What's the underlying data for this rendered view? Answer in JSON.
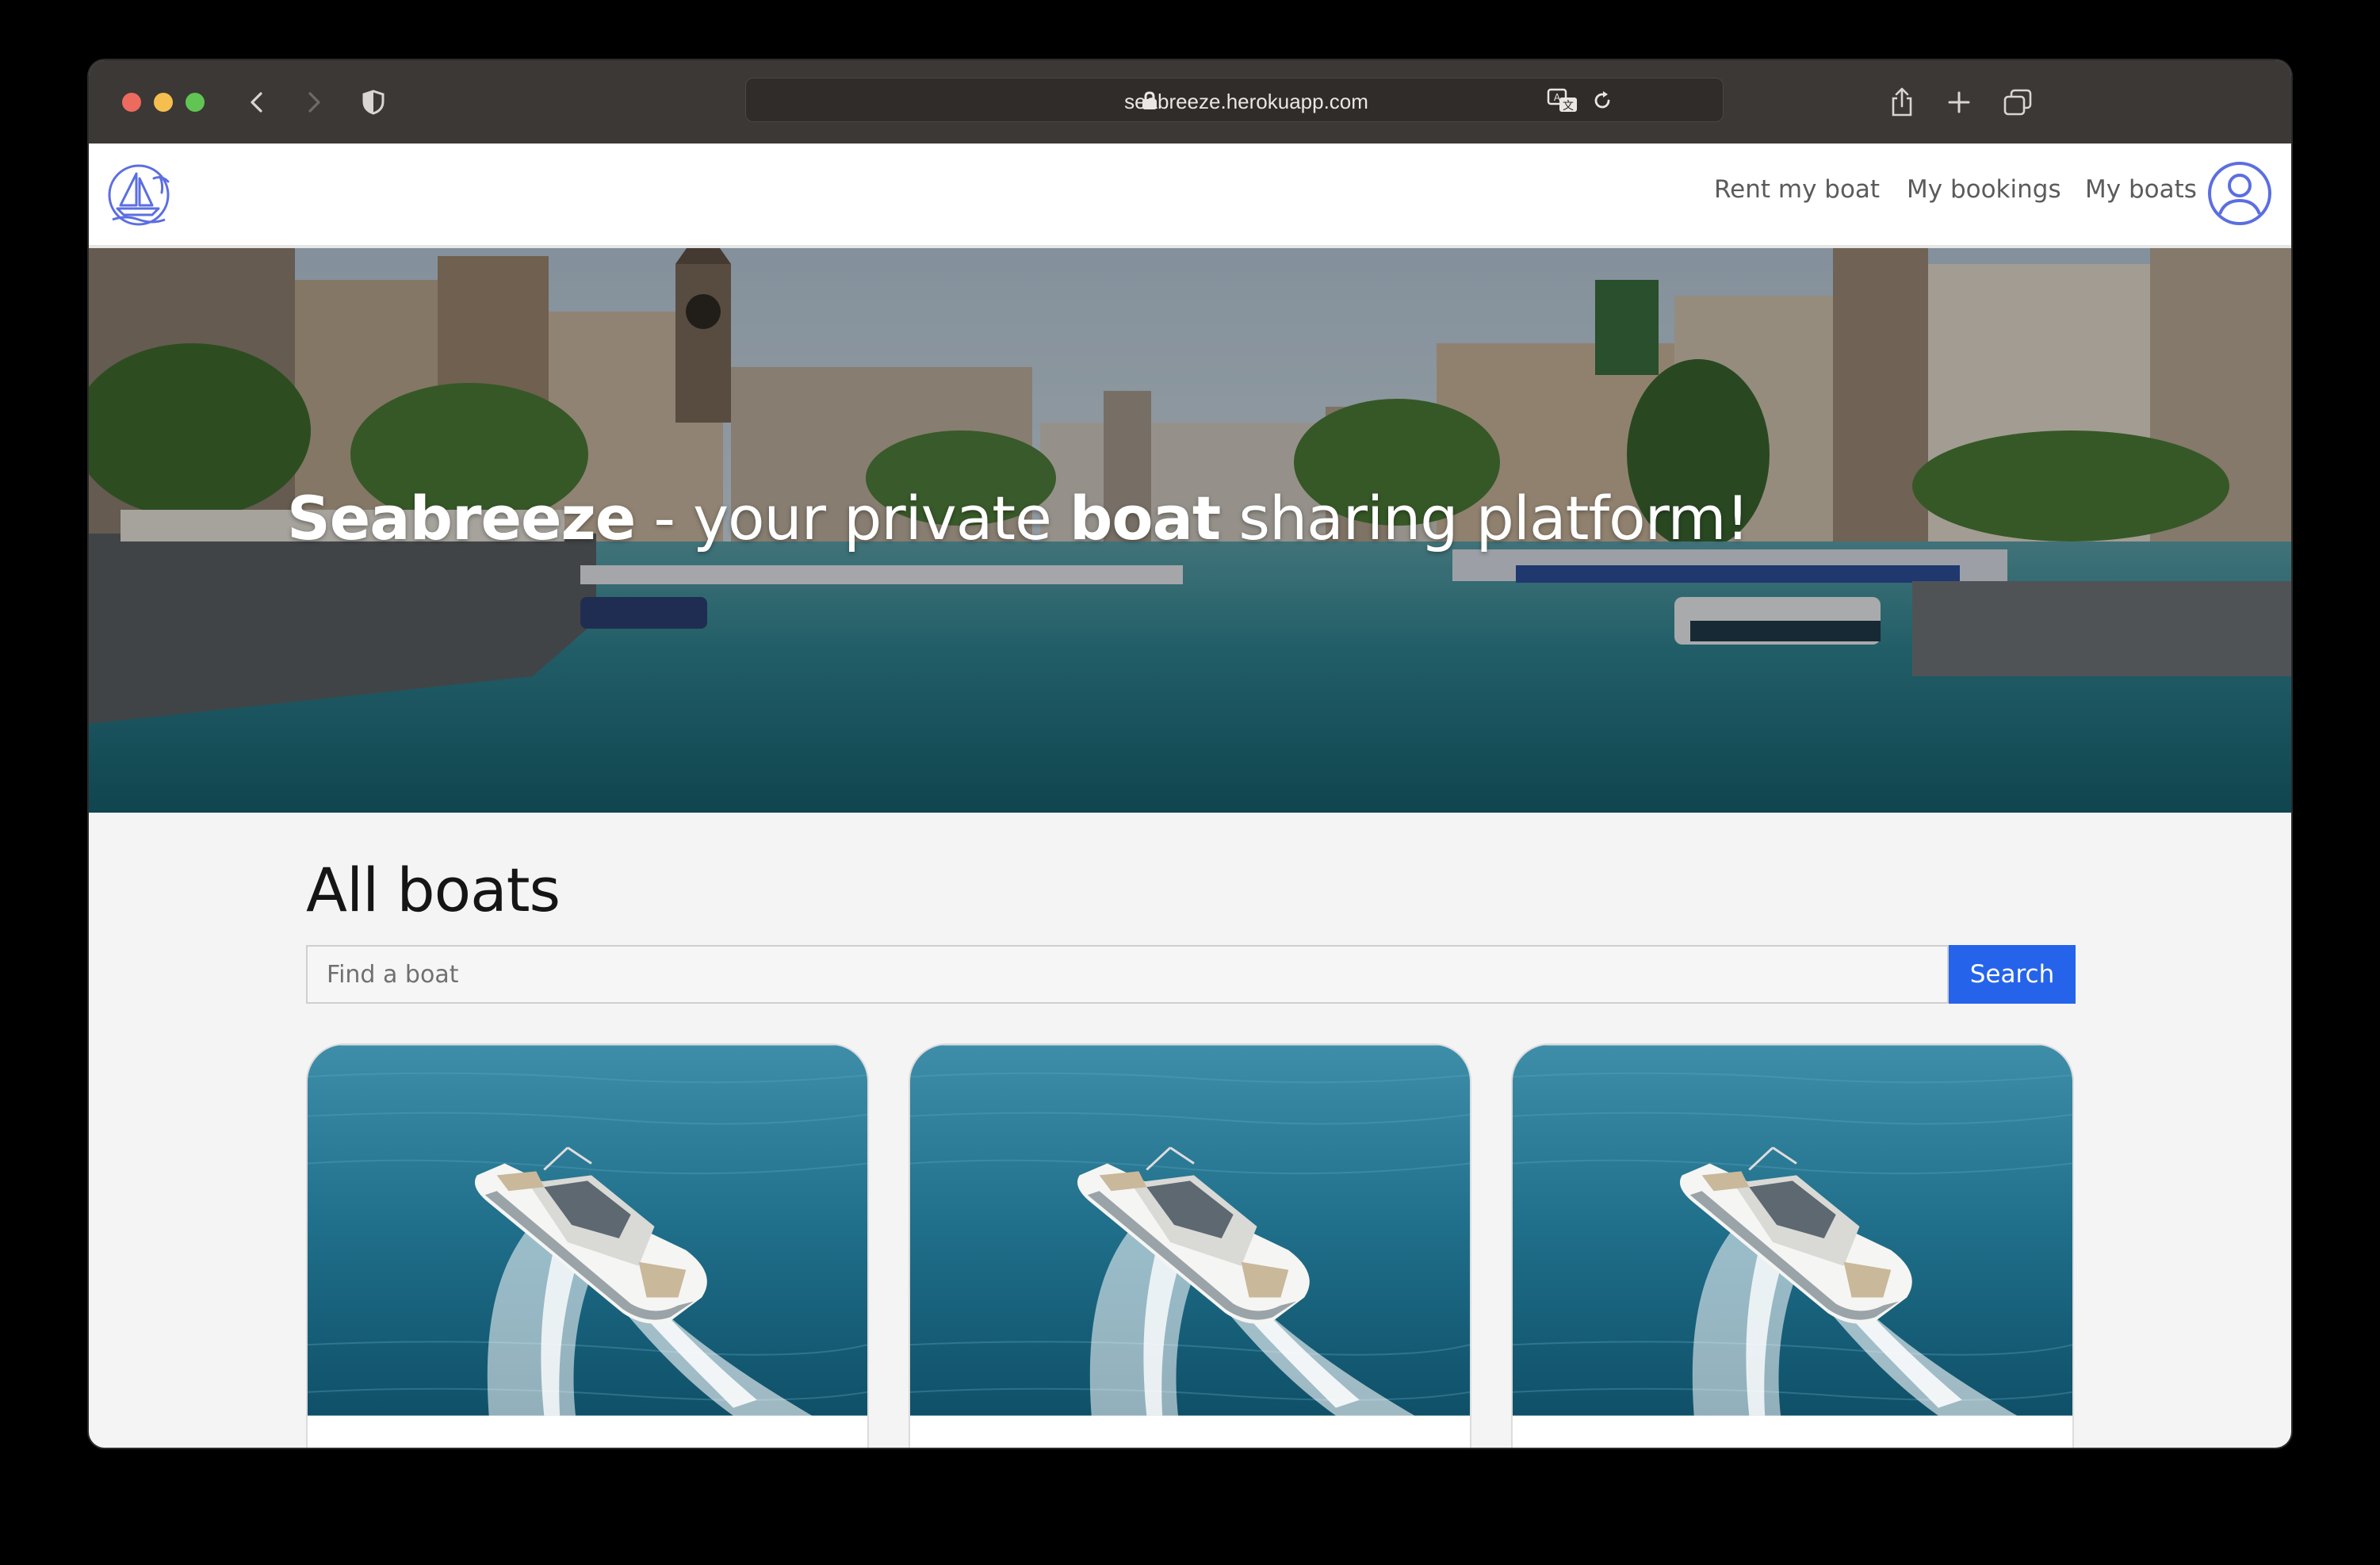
{
  "browser": {
    "url": "seabreeze.herokuapp.com",
    "colors": {
      "close": "#ed6a5e",
      "minimize": "#f5bf4f",
      "zoom": "#61c554",
      "chrome": "#3b3836"
    },
    "icons": [
      "back-icon",
      "forward-icon",
      "privacy-shield-icon",
      "lock-icon",
      "translate-icon",
      "reload-icon",
      "share-icon",
      "new-tab-icon",
      "tab-overview-icon"
    ]
  },
  "header": {
    "nav": {
      "rent": "Rent my boat",
      "bookings": "My bookings",
      "boats": "My boats"
    },
    "icons": [
      "sailboat-logo-icon",
      "user-avatar-icon"
    ],
    "accent_color": "#5b6ee1"
  },
  "hero": {
    "title_brand": "Seabreeze",
    "title_mid": " - your private ",
    "title_bold": "boat",
    "title_end": " sharing platform!"
  },
  "main": {
    "title": "All boats",
    "search": {
      "placeholder": "Find a boat",
      "value": "",
      "button_label": "Search",
      "button_color": "#2563eb"
    },
    "cards": [
      {
        "image": "yacht-aerial-photo"
      },
      {
        "image": "yacht-aerial-photo"
      },
      {
        "image": "yacht-aerial-photo"
      }
    ]
  }
}
